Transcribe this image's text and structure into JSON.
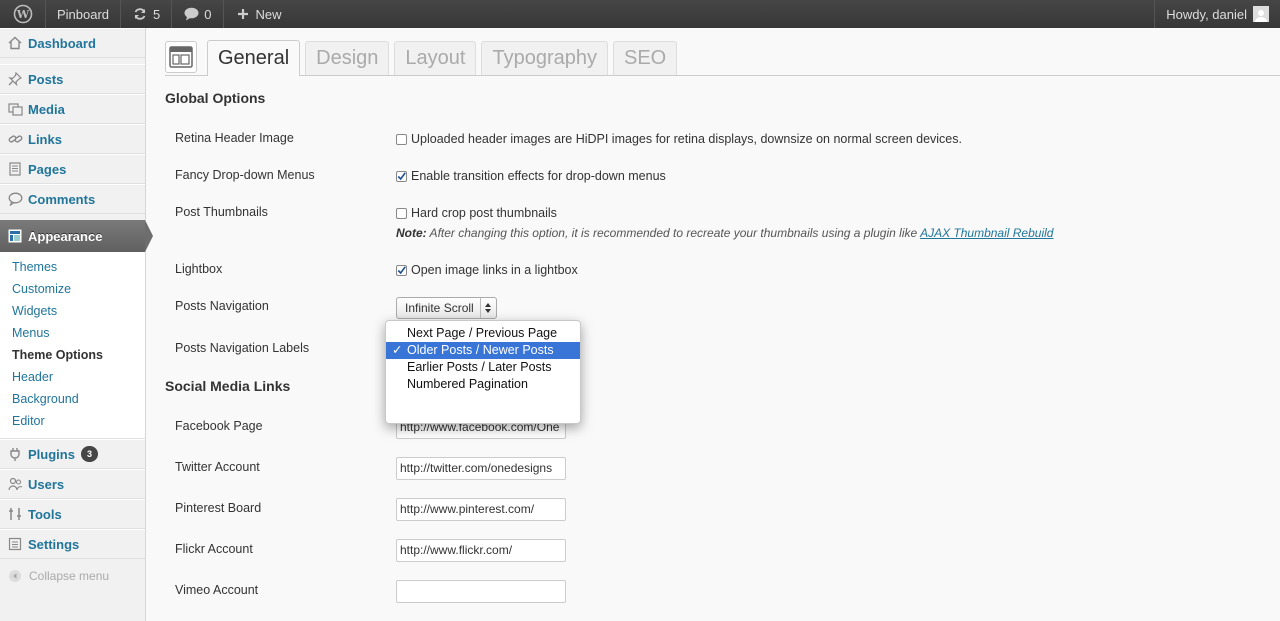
{
  "adminbar": {
    "site_name": "Pinboard",
    "updates_count": "5",
    "comments_count": "0",
    "new_label": "New",
    "howdy": "Howdy, daniel"
  },
  "sidebar": {
    "dashboard": "Dashboard",
    "posts": "Posts",
    "media": "Media",
    "links": "Links",
    "pages": "Pages",
    "comments": "Comments",
    "appearance": "Appearance",
    "appearance_sub": [
      "Themes",
      "Customize",
      "Widgets",
      "Menus",
      "Theme Options",
      "Header",
      "Background",
      "Editor"
    ],
    "plugins": "Plugins",
    "plugins_badge": "3",
    "users": "Users",
    "tools": "Tools",
    "settings": "Settings",
    "collapse": "Collapse menu"
  },
  "tabs": [
    "General",
    "Design",
    "Layout",
    "Typography",
    "SEO"
  ],
  "global": {
    "title": "Global Options",
    "retina_label": "Retina Header Image",
    "retina_text": "Uploaded header images are HiDPI images for retina displays, downsize on normal screen devices.",
    "fancy_label": "Fancy Drop-down Menus",
    "fancy_text": "Enable transition effects for drop-down menus",
    "thumbs_label": "Post Thumbnails",
    "thumbs_text": "Hard crop post thumbnails",
    "note_bold": "Note:",
    "note_text": " After changing this option, it is recommended to recreate your thumbnails using a plugin like ",
    "note_link": "AJAX Thumbnail Rebuild",
    "lightbox_label": "Lightbox",
    "lightbox_text": "Open image links in a lightbox",
    "nav_label": "Posts Navigation",
    "nav_value": "Infinite Scroll",
    "nav_labels_label": "Posts Navigation Labels",
    "nav_labels_options": [
      "Next Page / Previous Page",
      "Older Posts / Newer Posts",
      "Earlier Posts / Later Posts",
      "Numbered Pagination"
    ]
  },
  "social": {
    "title": "Social Media Links",
    "facebook_label": "Facebook Page",
    "facebook_value": "http://www.facebook.com/One",
    "twitter_label": "Twitter Account",
    "twitter_value": "http://twitter.com/onedesigns",
    "pinterest_label": "Pinterest Board",
    "pinterest_value": "http://www.pinterest.com/",
    "flickr_label": "Flickr Account",
    "flickr_value": "http://www.flickr.com/",
    "vimeo_label": "Vimeo Account",
    "vimeo_value": ""
  },
  "colors": {
    "link": "#21759b",
    "dropdown_selected": "#3875d7"
  }
}
